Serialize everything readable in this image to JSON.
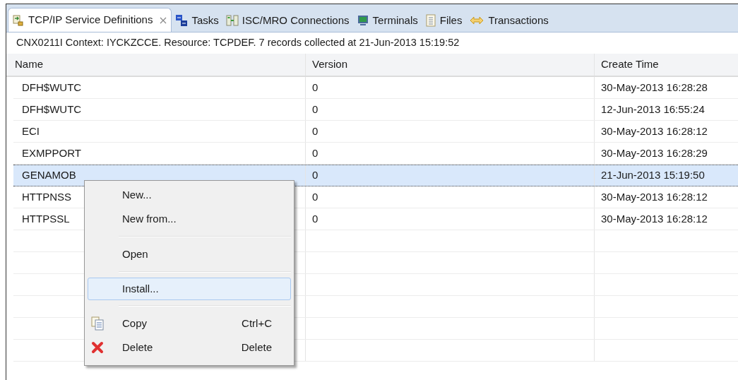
{
  "tabs": [
    {
      "label": "TCP/IP Service Definitions",
      "selected": true
    },
    {
      "label": "Tasks",
      "selected": false
    },
    {
      "label": "ISC/MRO Connections",
      "selected": false
    },
    {
      "label": "Terminals",
      "selected": false
    },
    {
      "label": "Files",
      "selected": false
    },
    {
      "label": "Transactions",
      "selected": false
    }
  ],
  "status_message": "CNX0211I Context: IYCKZCCE. Resource: TCPDEF. 7 records collected at 21-Jun-2013 15:19:52",
  "table": {
    "columns": [
      "Name",
      "Version",
      "Create Time"
    ],
    "rows": [
      {
        "cells": [
          "DFH$WUTC",
          "0",
          "30-May-2013 16:28:28"
        ],
        "selected": false
      },
      {
        "cells": [
          "DFH$WUTC",
          "0",
          "12-Jun-2013 16:55:24"
        ],
        "selected": false
      },
      {
        "cells": [
          "ECI",
          "0",
          "30-May-2013 16:28:12"
        ],
        "selected": false
      },
      {
        "cells": [
          "EXMPPORT",
          "0",
          "30-May-2013 16:28:29"
        ],
        "selected": false
      },
      {
        "cells": [
          "GENAMOB",
          "0",
          "21-Jun-2013 15:19:50"
        ],
        "selected": true
      },
      {
        "cells": [
          "HTTPNSS",
          "0",
          "30-May-2013 16:28:12"
        ],
        "selected": false
      },
      {
        "cells": [
          "HTTPSSL",
          "0",
          "30-May-2013 16:28:12"
        ],
        "selected": false
      }
    ]
  },
  "context_menu": [
    {
      "kind": "item",
      "label": "New...",
      "selected": false
    },
    {
      "kind": "item",
      "label": "New from...",
      "selected": false
    },
    {
      "kind": "separator"
    },
    {
      "kind": "item",
      "label": "Open",
      "selected": false
    },
    {
      "kind": "separator"
    },
    {
      "kind": "item",
      "label": "Install...",
      "selected": true
    },
    {
      "kind": "separator"
    },
    {
      "kind": "item",
      "label": "Copy",
      "shortcut": "Ctrl+C",
      "selected": false
    },
    {
      "kind": "item",
      "label": "Delete",
      "shortcut": "Delete",
      "selected": false
    }
  ]
}
